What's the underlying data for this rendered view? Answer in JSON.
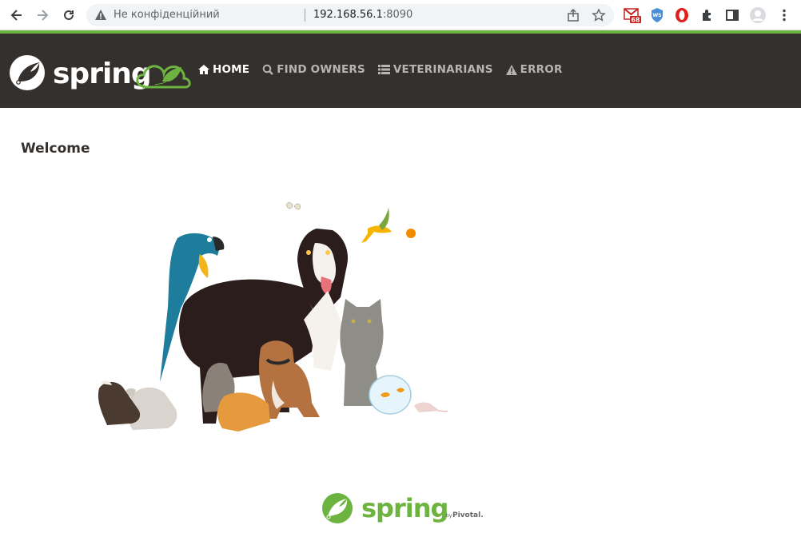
{
  "browser": {
    "security_label": "Не конфіденційний",
    "url_host": "192.168.56.1",
    "url_port": ":8090",
    "gmail_badge": "68",
    "ext_ws_label": "WS"
  },
  "colors": {
    "navbar_bg": "#34302d",
    "spring_green": "#6db33f",
    "menu_active": "#ffffff",
    "menu_inactive": "#b5b5b5"
  },
  "brand": {
    "logo_text": "spring"
  },
  "menu": [
    {
      "label": "HOME",
      "icon": "home-icon",
      "active": true
    },
    {
      "label": "FIND OWNERS",
      "icon": "search-icon",
      "active": false
    },
    {
      "label": "VETERINARIANS",
      "icon": "list-icon",
      "active": false
    },
    {
      "label": "ERROR",
      "icon": "warning-icon",
      "active": false
    }
  ],
  "main": {
    "heading": "Welcome"
  },
  "footer": {
    "logo_text": "spring",
    "by_text": "by",
    "company_text": "Pivotal."
  }
}
